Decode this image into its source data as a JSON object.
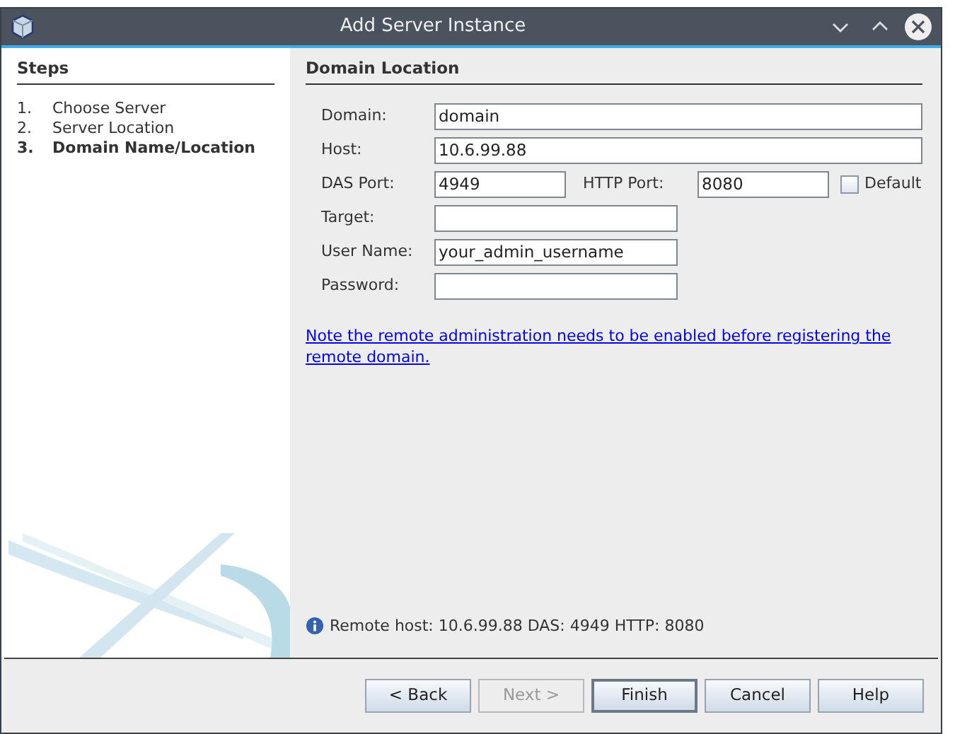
{
  "window": {
    "title": "Add Server Instance"
  },
  "steps": {
    "title": "Steps",
    "items": [
      {
        "number": "1.",
        "label": "Choose Server",
        "selected": false
      },
      {
        "number": "2.",
        "label": "Server Location",
        "selected": false
      },
      {
        "number": "3.",
        "label": "Domain Name/Location",
        "selected": true
      }
    ]
  },
  "panel": {
    "title": "Domain Location",
    "fields": [
      {
        "kind": "wide",
        "label": "Domain:",
        "value": "domain"
      },
      {
        "kind": "wide",
        "label": "Host:",
        "value": "10.6.99.88"
      },
      {
        "kind": "ports",
        "label": "DAS Port:",
        "value": "4949",
        "label_2": "HTTP Port:",
        "value_2": "8080",
        "checkbox": {
          "label": "Default",
          "checked": false
        }
      },
      {
        "kind": "short",
        "label": "Target:"
      },
      {
        "kind": "short",
        "label": "User Name:",
        "value": "your_admin_username"
      },
      {
        "kind": "short",
        "label": "Password:"
      }
    ],
    "note_link": "Note the remote administration needs to be enabled before registering the remote domain.",
    "info": "Remote host: 10.6.99.88 DAS: 4949 HTTP: 8080"
  },
  "buttons": [
    {
      "label": "< Back",
      "disabled": false,
      "default": false
    },
    {
      "label": "Next >",
      "disabled": true,
      "default": false
    },
    {
      "label": "Finish",
      "disabled": false,
      "default": true
    },
    {
      "label": "Cancel",
      "disabled": false,
      "default": false
    },
    {
      "label": "Help",
      "disabled": false,
      "default": false
    }
  ]
}
